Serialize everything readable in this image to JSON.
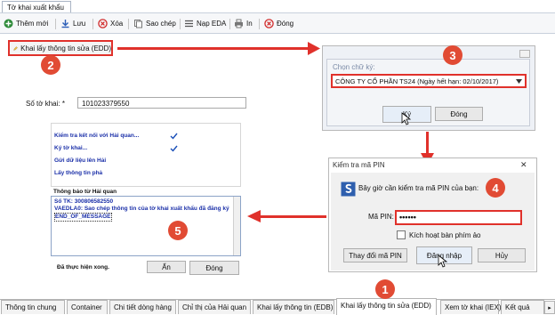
{
  "window": {
    "tab_title": "Tờ khai xuất khẩu"
  },
  "toolbar": {
    "new_label": "Thêm mới",
    "save_label": "Lưu",
    "delete_label": "Xóa",
    "copy_label": "Sao chép",
    "load_eda_label": "Nạp EDA",
    "print_label": "In",
    "close_label": "Đóng"
  },
  "main": {
    "edd_button_label": "Khai lấy thông tin sửa (EDD)",
    "declaration_number_label": "Số tờ khai: *",
    "declaration_number_value": "101023379550"
  },
  "process_panel": {
    "steps": [
      "Kiểm tra kết nối với Hải quan...",
      "Ký tờ khai...",
      "Gửi dữ liệu lên Hải",
      "Lấy thông tin phả"
    ],
    "notification_label": "Thông báo từ Hải quan",
    "messages": [
      "Số TK: 300806582550",
      "VAEDLA0: Sao chép thông tin của tờ khai xuất khẩu đã đăng ký",
      "END_OF_MESSAGE"
    ],
    "status": "Đã thực hiện xong.",
    "hide_label": "Ẩn",
    "close_label": "Đóng"
  },
  "signature_dialog": {
    "label": "Chọn chữ ký:",
    "selected": "CÔNG TY CỔ PHẦN TS24 (Ngày hết hạn: 02/10/2017)",
    "sign_label": "Ký",
    "close_label": "Đóng"
  },
  "pin_dialog": {
    "title": "Kiểm tra mã PIN",
    "prompt": "Bây giờ cần kiểm tra mã PIN của bạn:",
    "pin_label": "Mã PIN:",
    "pin_value": "••••••",
    "virtual_keyboard_label": "Kích hoạt bàn phím ảo",
    "change_pin_label": "Thay đổi mã PIN",
    "login_label": "Đăng nhập",
    "cancel_label": "Hủy"
  },
  "steps": [
    "1",
    "2",
    "3",
    "4",
    "5"
  ],
  "bottom_tabs": [
    "Thông tin chung",
    "Container",
    "Chi tiết dòng hàng",
    "Chỉ thị của Hải quan",
    "Khai lấy thông tin (EDB)",
    "Khai lấy thông tin sửa (EDD)",
    "Xem tờ khai (IEX)",
    "Kết quả"
  ],
  "colors": {
    "accent_red": "#e0312b",
    "badge_red": "#e14b34",
    "link_blue": "#1a2fa8"
  }
}
